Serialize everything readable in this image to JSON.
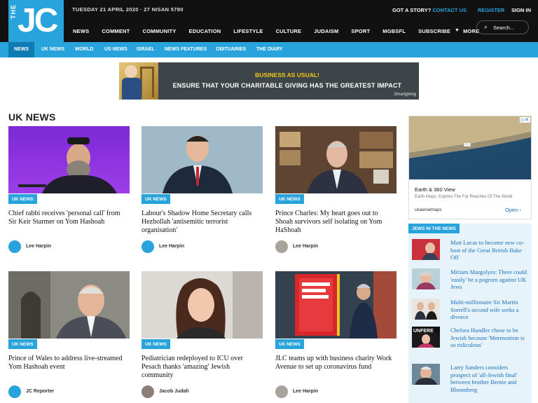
{
  "header": {
    "logo_small": "THE",
    "logo_main": "JC",
    "date": "TUESDAY 21 APRIL 2020  ·  27 NISAN 5780",
    "story_label": "GOT A STORY?",
    "story_link": "CONTACT US",
    "register": "REGISTER",
    "signin": "SIGN IN",
    "search_placeholder": "Search...",
    "nav": [
      "NEWS",
      "COMMENT",
      "COMMUNITY",
      "EDUCATION",
      "LIFESTYLE",
      "CULTURE",
      "JUDAISM",
      "SPORT",
      "MGBSFL",
      "SUBSCRIBE",
      "MORE"
    ]
  },
  "subnav": [
    "NEWS",
    "UK NEWS",
    "WORLD",
    "US NEWS",
    "ISRAEL",
    "NEWS FEATURES",
    "OBITUARIES",
    "THE DIARY"
  ],
  "ad": {
    "line1": "BUSINESS AS USUAL!",
    "line2": "ENSURE THAT YOUR CHARITABLE GIVING HAS THE GREATEST IMPACT",
    "brand": "Smartgiving"
  },
  "section_title": "UK NEWS",
  "articles": [
    {
      "tag": "UK NEWS",
      "headline": "Chief rabbi receives 'personal call' from Sir Keir Starmer on Yom Hashoah",
      "author": "Lee Harpin"
    },
    {
      "tag": "UK NEWS",
      "headline": "Labour's Shadow Home Secretary calls Hezbollah 'antisemitic terrorist organisation'",
      "author": "Lee Harpin"
    },
    {
      "tag": "UK NEWS",
      "headline": "Prince Charles: My heart goes out to Shoah survivors self isolating on Yom HaShoah",
      "author": "Lee Harpin"
    },
    {
      "tag": "UK NEWS",
      "headline": "Prince of Wales to address live-streamed Yom Hashoah event",
      "author": "JC Reporter"
    },
    {
      "tag": "UK NEWS",
      "headline": "Pediatrician redeployed to ICU over Pesach thanks 'amazing' Jewish community",
      "author": "Jacob Judah"
    },
    {
      "tag": "UK NEWS",
      "headline": "JLC teams up with business charity Work Avenue to set up coronavirus fund",
      "author": "Lee Harpin"
    }
  ],
  "sidebar_ad": {
    "title": "Earth & 360 View",
    "desc": "Earth Maps. Explore The Far Reaches Of The World",
    "domain": "ukaerialmaps",
    "cta": "Open  ›"
  },
  "jews_in_news": {
    "title": "JEWS IN THE NEWS",
    "items": [
      "Matt Lucas to become new co-host of the Great British Bake Off",
      "Miriam Margolyes: There could 'easily' be a pogrom against UK Jews",
      "Multi-millionaire Sir Martin Sorrell's second wife seeks a divorce",
      "Chelsea Handler chose to be Jewish because 'Mormonism is so ridiculous'",
      "Larry Sanders considers prospect of 'all-Jewish final' between brother Bernie and Bloomberg"
    ]
  },
  "colors": {
    "accent": "#29a3dc",
    "dark": "#111111",
    "link": "#1b6fb8"
  }
}
